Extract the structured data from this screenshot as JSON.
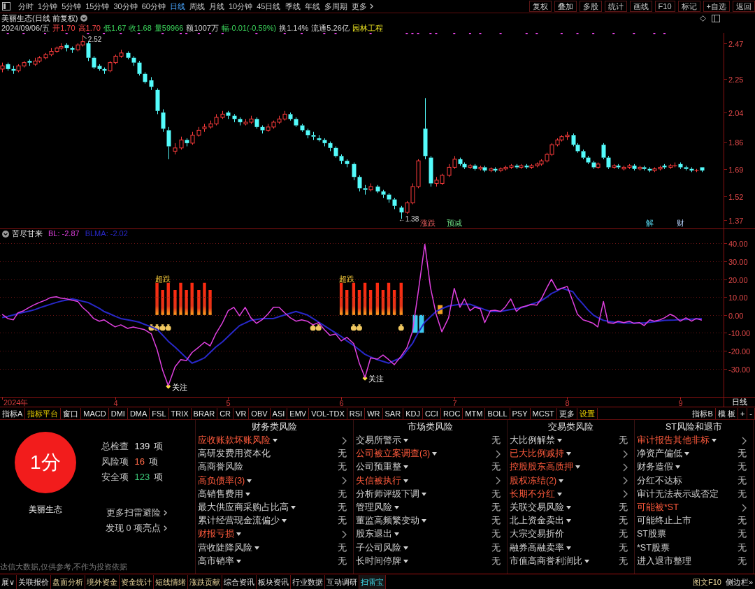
{
  "toolbar": {
    "periods": [
      {
        "label": "分时",
        "selected": false
      },
      {
        "label": "1分钟",
        "selected": false
      },
      {
        "label": "5分钟",
        "selected": false
      },
      {
        "label": "15分钟",
        "selected": false
      },
      {
        "label": "30分钟",
        "selected": false
      },
      {
        "label": "60分钟",
        "selected": false
      },
      {
        "label": "日线",
        "selected": true
      },
      {
        "label": "周线",
        "selected": false
      },
      {
        "label": "月线",
        "selected": false
      },
      {
        "label": "10分钟",
        "selected": false
      },
      {
        "label": "45日线",
        "selected": false
      },
      {
        "label": "季线",
        "selected": false
      },
      {
        "label": "年线",
        "selected": false
      },
      {
        "label": "多周期",
        "selected": false
      }
    ],
    "more": "更多",
    "actions": [
      "复权",
      "叠加",
      "多股",
      "统计",
      "画线",
      "F10",
      "标记",
      "+自选",
      "返回"
    ]
  },
  "header": {
    "title": "美丽生态(日线 前复权)",
    "quote": [
      {
        "text": "2024/09/06/五",
        "kind": "plain"
      },
      {
        "text": "开1.70",
        "kind": "up"
      },
      {
        "text": "高1.70",
        "kind": "up"
      },
      {
        "text": "低1.67",
        "kind": "down"
      },
      {
        "text": "收1.68",
        "kind": "down"
      },
      {
        "text": "量59966",
        "kind": "down"
      },
      {
        "text": "额1007万",
        "kind": "plain"
      },
      {
        "text": "幅-0.01(-0.59%)",
        "kind": "down"
      },
      {
        "text": "换1.14%",
        "kind": "plain"
      },
      {
        "text": "流通5.26亿",
        "kind": "plain"
      },
      {
        "text": "园林工程",
        "kind": "sector"
      }
    ]
  },
  "price_chart": {
    "events": [
      {
        "text": "涨跌",
        "kind": "drop"
      },
      {
        "text": "预减",
        "kind": "forecast"
      },
      {
        "text": "解",
        "kind": "unlock"
      },
      {
        "text": "财",
        "kind": "report"
      }
    ],
    "chart_data": {
      "type": "candlestick",
      "xlim": [
        2.981,
        9.661
      ],
      "ylim": [
        1.32,
        2.535
      ],
      "yticks": [
        {
          "value": 2.47,
          "label": "2.47"
        },
        {
          "value": 2.25,
          "label": "2.25"
        },
        {
          "value": 2.04,
          "label": "2.04"
        },
        {
          "value": 1.86,
          "label": "1.86"
        },
        {
          "value": 1.69,
          "label": "1.69"
        },
        {
          "value": 1.52,
          "label": "1.52"
        },
        {
          "value": 1.37,
          "label": "1.37"
        }
      ],
      "x": [
        3,
        3.05,
        3.1,
        3.14,
        3.19,
        3.24,
        3.29,
        3.33,
        3.38,
        3.43,
        3.48,
        3.52,
        3.57,
        3.62,
        3.67,
        3.71,
        3.76,
        3.81,
        3.86,
        3.9,
        3.95,
        4,
        4.05,
        4.11,
        4.16,
        4.21,
        4.26,
        4.32,
        4.37,
        4.42,
        4.47,
        4.53,
        4.58,
        4.63,
        4.68,
        4.74,
        4.79,
        4.84,
        4.89,
        4.95,
        5,
        5.05,
        5.1,
        5.15,
        5.2,
        5.25,
        5.3,
        5.35,
        5.4,
        5.45,
        5.5,
        5.55,
        5.6,
        5.65,
        5.7,
        5.75,
        5.8,
        5.85,
        5.9,
        5.95,
        6,
        6.05,
        6.11,
        6.16,
        6.21,
        6.26,
        6.32,
        6.37,
        6.42,
        6.47,
        6.53,
        6.58,
        6.63,
        6.68,
        6.74,
        6.79,
        6.84,
        6.89,
        6.95,
        7,
        7.05,
        7.09,
        7.14,
        7.18,
        7.23,
        7.27,
        7.32,
        7.36,
        7.41,
        7.45,
        7.5,
        7.55,
        7.59,
        7.64,
        7.68,
        7.73,
        7.77,
        7.82,
        7.86,
        7.91,
        7.95,
        8,
        8.05,
        8.09,
        8.14,
        8.18,
        8.23,
        8.27,
        8.32,
        8.36,
        8.41,
        8.45,
        8.5,
        8.55,
        8.59,
        8.64,
        8.68,
        8.73,
        8.77,
        8.82,
        8.86,
        8.91,
        8.95,
        9,
        9.05,
        9.1,
        9.14,
        9.19
      ],
      "ohlc": [
        [
          2.31,
          2.35,
          2.29,
          2.33
        ],
        [
          2.34,
          2.35,
          2.3,
          2.31
        ],
        [
          2.31,
          2.33,
          2.28,
          2.3
        ],
        [
          2.3,
          2.34,
          2.29,
          2.33
        ],
        [
          2.33,
          2.36,
          2.32,
          2.35
        ],
        [
          2.36,
          2.37,
          2.33,
          2.35
        ],
        [
          2.34,
          2.38,
          2.33,
          2.36
        ],
        [
          2.36,
          2.39,
          2.35,
          2.38
        ],
        [
          2.38,
          2.41,
          2.37,
          2.4
        ],
        [
          2.4,
          2.44,
          2.39,
          2.42
        ],
        [
          2.42,
          2.45,
          2.41,
          2.44
        ],
        [
          2.44,
          2.47,
          2.43,
          2.45
        ],
        [
          2.46,
          2.47,
          2.42,
          2.44
        ],
        [
          2.44,
          2.45,
          2.41,
          2.43
        ],
        [
          2.43,
          2.47,
          2.42,
          2.46
        ],
        [
          2.46,
          2.52,
          2.45,
          2.48
        ],
        [
          2.47,
          2.48,
          2.36,
          2.38
        ],
        [
          2.38,
          2.39,
          2.31,
          2.32
        ],
        [
          2.33,
          2.34,
          2.3,
          2.31
        ],
        [
          2.31,
          2.32,
          2.28,
          2.3
        ],
        [
          2.3,
          2.36,
          2.29,
          2.35
        ],
        [
          2.35,
          2.4,
          2.34,
          2.39
        ],
        [
          2.39,
          2.43,
          2.38,
          2.41
        ],
        [
          2.41,
          2.42,
          2.37,
          2.38
        ],
        [
          2.38,
          2.39,
          2.33,
          2.35
        ],
        [
          2.35,
          2.36,
          2.27,
          2.28
        ],
        [
          2.28,
          2.29,
          2.22,
          2.23
        ],
        [
          2.24,
          2.26,
          2.18,
          2.2
        ],
        [
          2.18,
          2.19,
          2.03,
          2.05
        ],
        [
          2.04,
          2.06,
          1.92,
          1.94
        ],
        [
          1.93,
          1.95,
          1.75,
          1.83
        ],
        [
          1.8,
          1.85,
          1.78,
          1.82
        ],
        [
          1.82,
          1.89,
          1.81,
          1.87
        ],
        [
          1.87,
          1.88,
          1.83,
          1.85
        ],
        [
          1.85,
          1.92,
          1.84,
          1.9
        ],
        [
          1.9,
          1.95,
          1.89,
          1.93
        ],
        [
          1.94,
          1.97,
          1.92,
          1.95
        ],
        [
          1.95,
          1.99,
          1.94,
          1.97
        ],
        [
          1.97,
          2.03,
          1.96,
          2.01
        ],
        [
          2.01,
          2.05,
          2.0,
          2.03
        ],
        [
          2.04,
          2.05,
          2.0,
          2.02
        ],
        [
          2.02,
          2.03,
          1.98,
          2.0
        ],
        [
          2.0,
          2.01,
          1.96,
          1.98
        ],
        [
          1.97,
          2.0,
          1.96,
          1.98
        ],
        [
          1.98,
          2.02,
          1.97,
          2.0
        ],
        [
          2.0,
          2.01,
          1.94,
          1.95
        ],
        [
          1.95,
          1.96,
          1.91,
          1.93
        ],
        [
          1.93,
          1.97,
          1.92,
          1.95
        ],
        [
          1.95,
          1.99,
          1.94,
          1.98
        ],
        [
          1.98,
          2.02,
          1.97,
          2.0
        ],
        [
          2.0,
          2.05,
          1.99,
          2.03
        ],
        [
          2.03,
          2.04,
          1.99,
          2.0
        ],
        [
          2.0,
          2.01,
          1.95,
          1.96
        ],
        [
          1.96,
          1.97,
          1.92,
          1.93
        ],
        [
          1.93,
          1.94,
          1.88,
          1.9
        ],
        [
          1.9,
          1.92,
          1.87,
          1.89
        ],
        [
          1.88,
          1.9,
          1.86,
          1.87
        ],
        [
          1.87,
          1.88,
          1.83,
          1.85
        ],
        [
          1.85,
          1.86,
          1.8,
          1.82
        ],
        [
          1.82,
          1.83,
          1.76,
          1.77
        ],
        [
          1.77,
          1.78,
          1.72,
          1.74
        ],
        [
          1.74,
          1.75,
          1.7,
          1.72
        ],
        [
          1.72,
          1.73,
          1.62,
          1.64
        ],
        [
          1.64,
          1.65,
          1.55,
          1.57
        ],
        [
          1.57,
          1.59,
          1.53,
          1.56
        ],
        [
          1.56,
          1.6,
          1.55,
          1.58
        ],
        [
          1.58,
          1.59,
          1.54,
          1.55
        ],
        [
          1.55,
          1.56,
          1.51,
          1.53
        ],
        [
          1.53,
          1.54,
          1.48,
          1.5
        ],
        [
          1.5,
          1.51,
          1.44,
          1.46
        ],
        [
          1.45,
          1.46,
          1.38,
          1.42
        ],
        [
          1.42,
          1.49,
          1.41,
          1.48
        ],
        [
          1.48,
          1.6,
          1.47,
          1.58
        ],
        [
          1.58,
          1.75,
          1.57,
          1.74
        ],
        [
          1.94,
          2.13,
          1.75,
          1.77
        ],
        [
          1.76,
          1.77,
          1.58,
          1.6
        ],
        [
          1.6,
          1.64,
          1.58,
          1.62
        ],
        [
          1.6,
          1.66,
          1.59,
          1.65
        ],
        [
          1.65,
          1.72,
          1.64,
          1.7
        ],
        [
          1.7,
          1.77,
          1.69,
          1.75
        ],
        [
          1.75,
          1.76,
          1.71,
          1.72
        ],
        [
          1.72,
          1.73,
          1.69,
          1.7
        ],
        [
          1.7,
          1.72,
          1.69,
          1.71
        ],
        [
          1.71,
          1.72,
          1.68,
          1.69
        ],
        [
          1.69,
          1.71,
          1.68,
          1.7
        ],
        [
          1.7,
          1.71,
          1.67,
          1.68
        ],
        [
          1.68,
          1.7,
          1.67,
          1.69
        ],
        [
          1.69,
          1.7,
          1.67,
          1.68
        ],
        [
          1.68,
          1.7,
          1.67,
          1.69
        ],
        [
          1.69,
          1.71,
          1.68,
          1.7
        ],
        [
          1.7,
          1.72,
          1.69,
          1.71
        ],
        [
          1.71,
          1.72,
          1.69,
          1.7
        ],
        [
          1.7,
          1.72,
          1.69,
          1.71
        ],
        [
          1.71,
          1.72,
          1.69,
          1.7
        ],
        [
          1.7,
          1.72,
          1.69,
          1.71
        ],
        [
          1.71,
          1.73,
          1.7,
          1.72
        ],
        [
          1.72,
          1.75,
          1.71,
          1.74
        ],
        [
          1.74,
          1.79,
          1.73,
          1.78
        ],
        [
          1.78,
          1.85,
          1.77,
          1.84
        ],
        [
          1.84,
          1.88,
          1.83,
          1.87
        ],
        [
          1.87,
          1.9,
          1.86,
          1.89
        ],
        [
          1.89,
          1.92,
          1.87,
          1.9
        ],
        [
          1.9,
          1.91,
          1.83,
          1.84
        ],
        [
          1.84,
          1.85,
          1.79,
          1.8
        ],
        [
          1.8,
          1.81,
          1.75,
          1.76
        ],
        [
          1.76,
          1.77,
          1.72,
          1.73
        ],
        [
          1.73,
          1.74,
          1.69,
          1.7
        ],
        [
          1.7,
          1.73,
          1.69,
          1.72
        ],
        [
          1.84,
          1.85,
          1.75,
          1.76
        ],
        [
          1.76,
          1.77,
          1.69,
          1.7
        ],
        [
          1.7,
          1.72,
          1.69,
          1.71
        ],
        [
          1.71,
          1.72,
          1.69,
          1.7
        ],
        [
          1.69,
          1.71,
          1.68,
          1.7
        ],
        [
          1.7,
          1.72,
          1.69,
          1.71
        ],
        [
          1.71,
          1.72,
          1.68,
          1.69
        ],
        [
          1.69,
          1.71,
          1.68,
          1.7
        ],
        [
          1.7,
          1.71,
          1.68,
          1.69
        ],
        [
          1.69,
          1.7,
          1.67,
          1.68
        ],
        [
          1.68,
          1.7,
          1.67,
          1.69
        ],
        [
          1.69,
          1.71,
          1.68,
          1.7
        ],
        [
          1.71,
          1.72,
          1.69,
          1.7
        ],
        [
          1.7,
          1.72,
          1.69,
          1.71
        ],
        [
          1.71,
          1.73,
          1.7,
          1.71
        ],
        [
          1.72,
          1.73,
          1.69,
          1.7
        ],
        [
          1.7,
          1.71,
          1.68,
          1.69
        ],
        [
          1.69,
          1.7,
          1.67,
          1.68
        ],
        [
          1.68,
          1.69,
          1.67,
          1.68
        ],
        [
          1.7,
          1.7,
          1.67,
          1.68
        ]
      ],
      "annotations": [
        "2.52",
        "←1.38"
      ]
    }
  },
  "indicator": {
    "name": "苦尽甘来",
    "readings": [
      {
        "text": ": -2.87"
      },
      {
        "text": ": -2.02"
      }
    ],
    "chart_data": {
      "type": "line",
      "xlim": [
        2.981,
        9.661
      ],
      "ylim": [
        -51.3,
        48.4
      ],
      "grid": true,
      "yticks": [
        {
          "value": 40,
          "label": "40.00"
        },
        {
          "value": 30,
          "label": "30.00"
        },
        {
          "value": 20,
          "label": "20.00"
        },
        {
          "value": 10,
          "label": "10.00"
        },
        {
          "value": 0,
          "label": "0.00"
        },
        {
          "value": -10,
          "label": "-10.00"
        },
        {
          "value": -20,
          "label": "-20.00"
        },
        {
          "value": -30,
          "label": "-30.00"
        }
      ],
      "xticks": [
        {
          "value": 4,
          "label": "4"
        },
        {
          "value": 5,
          "label": "5"
        },
        {
          "value": 6,
          "label": "6"
        },
        {
          "value": 7,
          "label": "7"
        },
        {
          "value": 8,
          "label": "8"
        },
        {
          "value": 9,
          "label": "9"
        }
      ],
      "x": [
        3,
        3.05,
        3.1,
        3.14,
        3.19,
        3.24,
        3.29,
        3.33,
        3.38,
        3.43,
        3.48,
        3.52,
        3.57,
        3.62,
        3.67,
        3.71,
        3.76,
        3.81,
        3.86,
        3.9,
        3.95,
        4,
        4.05,
        4.11,
        4.16,
        4.21,
        4.26,
        4.32,
        4.37,
        4.42,
        4.47,
        4.53,
        4.58,
        4.63,
        4.68,
        4.74,
        4.79,
        4.84,
        4.89,
        4.95,
        5,
        5.05,
        5.1,
        5.15,
        5.2,
        5.25,
        5.3,
        5.35,
        5.4,
        5.45,
        5.5,
        5.55,
        5.6,
        5.65,
        5.7,
        5.75,
        5.8,
        5.85,
        5.9,
        5.95,
        6,
        6.05,
        6.11,
        6.16,
        6.21,
        6.26,
        6.32,
        6.37,
        6.42,
        6.47,
        6.53,
        6.58,
        6.63,
        6.68,
        6.74,
        6.79,
        6.84,
        6.89,
        6.95,
        7,
        7.05,
        7.09,
        7.14,
        7.18,
        7.23,
        7.27,
        7.32,
        7.36,
        7.41,
        7.45,
        7.5,
        7.55,
        7.59,
        7.64,
        7.68,
        7.73,
        7.77,
        7.82,
        7.86,
        7.91,
        7.95,
        8,
        8.05,
        8.09,
        8.14,
        8.18,
        8.23,
        8.27,
        8.32,
        8.36,
        8.41,
        8.45,
        8.5,
        8.55,
        8.59,
        8.64,
        8.68,
        8.73,
        8.77,
        8.82,
        8.86,
        8.91,
        8.95,
        9,
        9.05,
        9.1,
        9.14,
        9.19
      ],
      "series": [
        {
          "name": "BL",
          "color": "#e040e0",
          "values": [
            0.4,
            -2,
            -2.7,
            1.2,
            2.4,
            4.3,
            5.9,
            7,
            8.2,
            9.8,
            10.2,
            9.4,
            9,
            8.2,
            7.5,
            4.3,
            1.6,
            -2,
            -3.5,
            -2.7,
            -4.7,
            -6.7,
            -5.5,
            -7.5,
            -6.7,
            -7.5,
            -8.2,
            -10.6,
            -19.2,
            -31,
            -39.6,
            -29,
            -25,
            -25.5,
            -21,
            -18,
            -15.3,
            -17.3,
            -10.6,
            -4.3,
            2.4,
            4.3,
            -0.4,
            4.3,
            -1.6,
            -4.7,
            -2.7,
            0.4,
            4.3,
            4.3,
            1.2,
            -1.6,
            -3.5,
            -2.7,
            -3.5,
            -5.5,
            -4.3,
            -8.2,
            -11.4,
            -10.6,
            -14.5,
            -12.5,
            -16,
            -27,
            -35,
            -24,
            -24.7,
            -22.4,
            -25,
            -27.8,
            -23,
            -18.4,
            -9.4,
            12.2,
            39.6,
            15.3,
            0.4,
            -9.4,
            -1.6,
            14.9,
            4.3,
            9,
            2.4,
            4.3,
            3.5,
            -4.3,
            2.4,
            2.7,
            2,
            4.3,
            9,
            2,
            4.3,
            5.1,
            5.9,
            5.5,
            9,
            15.3,
            20,
            14.1,
            14.9,
            16,
            7.5,
            0.4,
            -2.7,
            -3.5,
            -4.7,
            -6.7,
            7.5,
            -4.3,
            -4.7,
            -3.5,
            -4.3,
            -3.5,
            -4.7,
            -4.3,
            -5.9,
            -2.7,
            -3.5,
            -2.7,
            -1.6,
            0.4,
            -0.8,
            -3.5,
            -1.6,
            -3.5,
            -2,
            -2.9
          ]
        },
        {
          "name": "BLMA",
          "color": "#2828c8",
          "values": [
            -1.5,
            -0.8,
            0,
            0.8,
            1.5,
            2.2,
            3,
            4,
            5,
            6,
            7,
            7.7,
            8.3,
            9,
            8.3,
            7.7,
            7,
            5.3,
            3.7,
            2,
            0.7,
            -0.7,
            -2,
            -2.7,
            -3.3,
            -4,
            -5.3,
            -6.7,
            -8,
            -11.3,
            -14.7,
            -18,
            -21,
            -24,
            -27,
            -25.5,
            -24,
            -21,
            -18,
            -15,
            -12,
            -9,
            -6,
            -4.5,
            -3,
            -2.5,
            -2,
            -2,
            -2,
            -1,
            0,
            1,
            2,
            1,
            0,
            -2,
            -4,
            -6,
            -8,
            -10,
            -12,
            -14.5,
            -17,
            -19.5,
            -22,
            -23.5,
            -25,
            -26,
            -27,
            -25.5,
            -24,
            -20,
            -16,
            -10,
            -4,
            -1,
            2,
            3.5,
            5,
            5.5,
            6,
            6,
            6,
            5,
            4,
            3,
            2,
            2,
            2,
            2.5,
            3,
            3.5,
            4,
            5,
            6,
            7,
            8,
            10,
            12,
            13.5,
            15,
            14,
            13,
            9.5,
            6,
            3,
            0,
            -1.5,
            -3,
            -3.5,
            -4,
            -4.2,
            -4.5,
            -4.5,
            -4.5,
            -4.5,
            -4.5,
            -4.1,
            -3.8,
            -3.4,
            -3,
            -2.9,
            -2.8,
            -2.6,
            -2.5,
            -2.3,
            -2.2,
            -2
          ]
        }
      ],
      "annotations": [
        "超跌",
        "超跌",
        "关注",
        "关注"
      ]
    }
  },
  "date_axis": {
    "year_label": "2024年",
    "period": "日线"
  },
  "indicator_tabs": {
    "items": [
      {
        "label": "指标A",
        "kind": "plain"
      },
      {
        "label": "指标平台",
        "kind": "highlight"
      },
      {
        "label": "窗口",
        "kind": "plain"
      },
      {
        "label": "MACD",
        "kind": "plain"
      },
      {
        "label": "DMI",
        "kind": "plain"
      },
      {
        "label": "DMA",
        "kind": "plain"
      },
      {
        "label": "FSL",
        "kind": "plain"
      },
      {
        "label": "TRIX",
        "kind": "plain"
      },
      {
        "label": "BRAR",
        "kind": "plain"
      },
      {
        "label": "CR",
        "kind": "plain"
      },
      {
        "label": "VR",
        "kind": "plain"
      },
      {
        "label": "OBV",
        "kind": "plain"
      },
      {
        "label": "ASI",
        "kind": "plain"
      },
      {
        "label": "EMV",
        "kind": "plain"
      },
      {
        "label": "VOL-TDX",
        "kind": "plain"
      },
      {
        "label": "RSI",
        "kind": "plain"
      },
      {
        "label": "WR",
        "kind": "plain"
      },
      {
        "label": "SAR",
        "kind": "plain"
      },
      {
        "label": "KDJ",
        "kind": "plain"
      },
      {
        "label": "CCI",
        "kind": "plain"
      },
      {
        "label": "ROC",
        "kind": "plain"
      },
      {
        "label": "MTM",
        "kind": "plain"
      },
      {
        "label": "BOLL",
        "kind": "plain"
      },
      {
        "label": "PSY",
        "kind": "plain"
      },
      {
        "label": "MCST",
        "kind": "plain"
      },
      {
        "label": "更多",
        "kind": "plain"
      },
      {
        "label": "设置",
        "kind": "highlight"
      }
    ],
    "right": [
      "指标B",
      "模 板",
      "+",
      "-"
    ]
  },
  "scan": {
    "score": "1分",
    "stats": [
      {
        "label": "总检查",
        "value": "139",
        "unit": "项",
        "kind": "total"
      },
      {
        "label": "风险项",
        "value": "16",
        "unit": "项",
        "kind": "risk"
      },
      {
        "label": "安全项",
        "value": "123",
        "unit": "项",
        "kind": "safe"
      }
    ],
    "stock": "美丽生态",
    "links": [
      "更多扫雷避险",
      "发现 0 项亮点"
    ],
    "disclaimer": "达信大数据,仅供参考,不作为投资依据",
    "columns": [
      {
        "title": "财务类风险",
        "items": [
          {
            "label": "应收账款坏账风险",
            "menu": true,
            "risk": true
          },
          {
            "label": "高研发费用资本化",
            "menu": false,
            "risk": false,
            "status": "无"
          },
          {
            "label": "高商誉风险",
            "menu": false,
            "risk": false,
            "status": "无"
          },
          {
            "label": "高负债率(3)",
            "menu": true,
            "risk": true
          },
          {
            "label": "高销售费用",
            "menu": true,
            "risk": false,
            "status": "无"
          },
          {
            "label": "最大供应商采购占比高",
            "menu": true,
            "risk": false,
            "status": "无"
          },
          {
            "label": "累计经营现金流偏少",
            "menu": true,
            "risk": false,
            "status": "无"
          },
          {
            "label": "财报亏损",
            "menu": true,
            "risk": true
          },
          {
            "label": "营收陡降风险",
            "menu": true,
            "risk": false,
            "status": "无"
          },
          {
            "label": "高市销率",
            "menu": true,
            "risk": false,
            "status": "无"
          }
        ]
      },
      {
        "title": "市场类风险",
        "items": [
          {
            "label": "交易所警示",
            "menu": true,
            "risk": false,
            "status": "无"
          },
          {
            "label": "公司被立案调查(3)",
            "menu": true,
            "risk": true
          },
          {
            "label": "公司预重整",
            "menu": true,
            "risk": false,
            "status": "无"
          },
          {
            "label": "失信被执行",
            "menu": true,
            "risk": true
          },
          {
            "label": "分析师评级下调",
            "menu": true,
            "risk": false,
            "status": "无"
          },
          {
            "label": "管理风险",
            "menu": true,
            "risk": false,
            "status": "无"
          },
          {
            "label": "董监高频繁变动",
            "menu": true,
            "risk": false,
            "status": "无"
          },
          {
            "label": "股东退出",
            "menu": true,
            "risk": false,
            "status": "无"
          },
          {
            "label": "子公司风险",
            "menu": true,
            "risk": false,
            "status": "无"
          },
          {
            "label": "长时间停牌",
            "menu": true,
            "risk": false,
            "status": "无"
          }
        ]
      },
      {
        "title": "交易类风险",
        "items": [
          {
            "label": "大比例解禁",
            "menu": true,
            "risk": false,
            "status": "无"
          },
          {
            "label": "已大比例减持",
            "menu": true,
            "risk": true
          },
          {
            "label": "控股股东高质押",
            "menu": true,
            "risk": true
          },
          {
            "label": "股权冻结(2)",
            "menu": true,
            "risk": true
          },
          {
            "label": "长期不分红",
            "menu": true,
            "risk": true
          },
          {
            "label": "关联交易风险",
            "menu": true,
            "risk": false,
            "status": "无"
          },
          {
            "label": "北上资金卖出",
            "menu": true,
            "risk": false,
            "status": "无"
          },
          {
            "label": "大宗交易折价",
            "menu": false,
            "risk": false,
            "status": "无"
          },
          {
            "label": "融券高融卖率",
            "menu": true,
            "risk": false,
            "status": "无"
          },
          {
            "label": "市值高商誉利润比",
            "menu": true,
            "risk": false,
            "status": "无"
          }
        ]
      },
      {
        "title": "ST风险和退市",
        "items": [
          {
            "label": "审计报告其他非标",
            "menu": true,
            "risk": true
          },
          {
            "label": "净资产偏低",
            "menu": true,
            "risk": false,
            "status": "无"
          },
          {
            "label": "财务造假",
            "menu": true,
            "risk": false,
            "status": "无"
          },
          {
            "label": "分红不达标",
            "menu": false,
            "risk": false,
            "status": "无"
          },
          {
            "label": "审计无法表示或否定",
            "menu": false,
            "risk": false,
            "status": "无"
          },
          {
            "label": "可能被*ST",
            "menu": false,
            "risk": true
          },
          {
            "label": "可能终止上市",
            "menu": false,
            "risk": false,
            "status": "无"
          },
          {
            "label": "ST股票",
            "menu": false,
            "risk": false,
            "status": "无"
          },
          {
            "label": "*ST股票",
            "menu": false,
            "risk": false,
            "status": "无"
          },
          {
            "label": "进入退市整理",
            "menu": false,
            "risk": false,
            "status": "无"
          }
        ]
      }
    ]
  },
  "bottom_tabs": [
    {
      "label": "展∨",
      "kind": "plain",
      "selected": false
    },
    {
      "label": "关联报价",
      "kind": "plain",
      "selected": false
    },
    {
      "label": "盘面分析",
      "kind": "feature",
      "selected": false
    },
    {
      "label": "境外资金",
      "kind": "feature",
      "selected": false
    },
    {
      "label": "资金统计",
      "kind": "feature",
      "selected": false
    },
    {
      "label": "短线情绪",
      "kind": "feature",
      "selected": false
    },
    {
      "label": "涨跌贡献",
      "kind": "feature",
      "selected": false
    },
    {
      "label": "综合资讯",
      "kind": "plain",
      "selected": false
    },
    {
      "label": "板块资讯",
      "kind": "plain",
      "selected": false
    },
    {
      "label": "行业数据",
      "kind": "plain",
      "selected": false
    },
    {
      "label": "互动调研",
      "kind": "plain",
      "selected": false
    },
    {
      "label": "扫雷宝",
      "kind": "plain",
      "selected": true
    }
  ],
  "bottom_links": [
    "图文F10",
    "侧边栏»"
  ]
}
